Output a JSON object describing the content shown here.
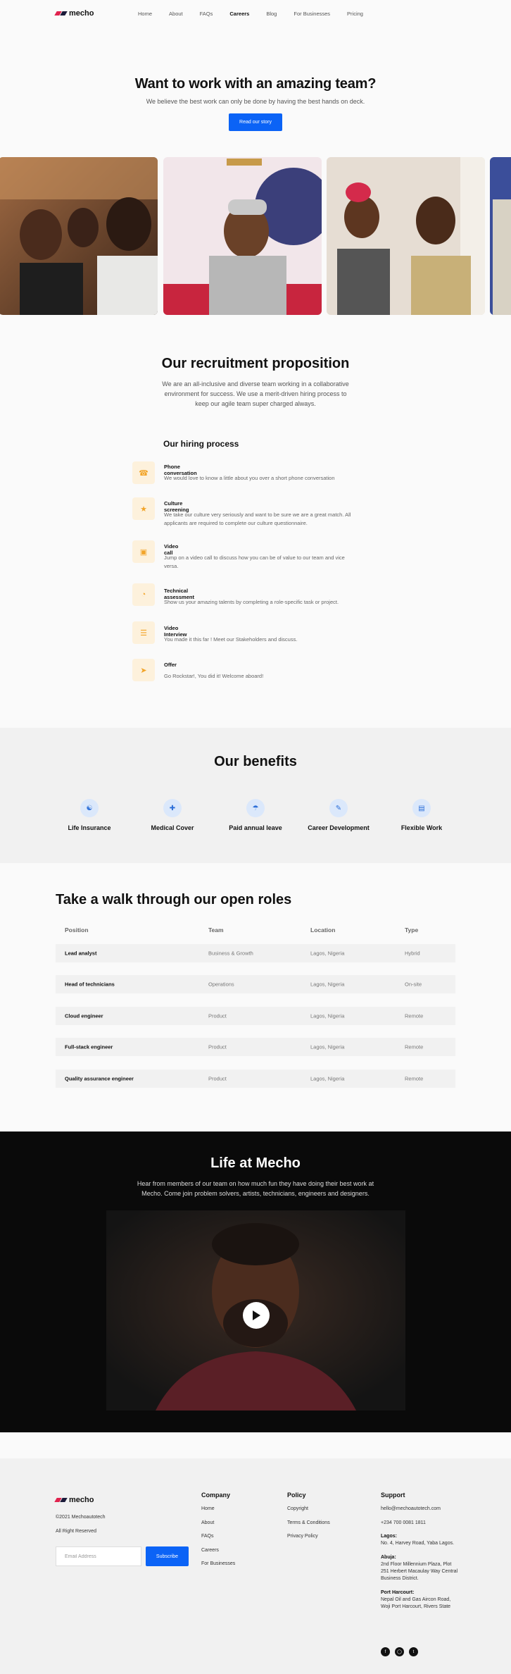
{
  "brand": {
    "name": "mecho",
    "colors": {
      "primary": "#0b63f6",
      "mark_red": "#e0234e",
      "mark_dark": "#1b1b3a",
      "accent_orange": "#f2a428"
    }
  },
  "nav": {
    "links": [
      {
        "label": "Home",
        "active": false
      },
      {
        "label": "About",
        "active": false
      },
      {
        "label": "FAQs",
        "active": false
      },
      {
        "label": "Careers",
        "active": true
      },
      {
        "label": "Blog",
        "active": false
      },
      {
        "label": "For Businesses",
        "active": false
      },
      {
        "label": "Pricing",
        "active": false
      }
    ]
  },
  "hero": {
    "title": "Want to work with an amazing team?",
    "subtitle": "We believe the best work can only be done by having the best hands on deck.",
    "cta": "Read our story"
  },
  "recruitment": {
    "title": "Our recruitment proposition",
    "text": "We are an all-inclusive and diverse team working in a collaborative environment for success. We use a merit-driven hiring process to keep our agile team super charged always."
  },
  "hiring": {
    "title": "Our hiring process",
    "steps": [
      {
        "icon": "phone-icon",
        "title": "Phone conversation",
        "desc": "We would love to know a little about you over a short phone conversation"
      },
      {
        "icon": "culture-icon",
        "title": "Culture screening",
        "desc": "We take our culture very seriously and want to be sure we are a great match. All applicants are required to complete our culture questionnaire."
      },
      {
        "icon": "video-call-icon",
        "title": "Video call",
        "desc": "Jump on a video call to discuss how you can be of value to our team and vice versa."
      },
      {
        "icon": "assessment-icon",
        "title": "Technical assessment",
        "desc": "Show us your amazing talents by completing a role-specific task or project."
      },
      {
        "icon": "interview-icon",
        "title": "Video Interview",
        "desc": "You made it this far ! Meet our Stakeholders and discuss."
      },
      {
        "icon": "offer-icon",
        "title": "Offer",
        "desc": "Go Rockstar!, You did it! Welcome aboard!"
      }
    ]
  },
  "benefits": {
    "title": "Our benefits",
    "items": [
      {
        "icon": "life-insurance-icon",
        "label": "Life Insurance"
      },
      {
        "icon": "medical-icon",
        "label": "Medical Cover"
      },
      {
        "icon": "umbrella-icon",
        "label": "Paid annual leave"
      },
      {
        "icon": "career-icon",
        "label": "Career Development"
      },
      {
        "icon": "flexible-icon",
        "label": "Flexible Work"
      }
    ]
  },
  "roles": {
    "title": "Take a walk through our open roles",
    "headers": [
      "Position",
      "Team",
      "Location",
      "Type"
    ],
    "rows": [
      [
        "Lead analyst",
        "Business & Growth",
        "Lagos, Nigeria",
        "Hybrid"
      ],
      [
        "Head of technicians",
        "Operations",
        "Lagos, Nigeria",
        "On-site"
      ],
      [
        "Cloud engineer",
        "Product",
        "Lagos, Nigeria",
        "Remote"
      ],
      [
        "Full-stack engineer",
        "Product",
        "Lagos, Nigeria",
        "Remote"
      ],
      [
        "Quality assurance engineer",
        "Product",
        "Lagos, Nigeria",
        "Remote"
      ]
    ]
  },
  "life": {
    "title": "Life at Mecho",
    "text": "Hear from members of our team on how much fun they have doing their best work at Mecho. Come join problem solvers, artists, technicians, engineers and designers."
  },
  "footer": {
    "copyright": "©2021 Mechoautotech",
    "rights": "All Right Reserved",
    "email_placeholder": "Email Address",
    "subscribe": "Subscribe",
    "company": {
      "title": "Company",
      "links": [
        "Home",
        "About",
        "FAQs",
        "Careers",
        "For Businesses"
      ]
    },
    "policy": {
      "title": "Policy",
      "links": [
        "Copyright",
        "Terms & Conditions",
        "Privacy Policy"
      ]
    },
    "support": {
      "title": "Support",
      "email": "hello@mechoautotech.com",
      "phone": "+234 700 0081 1811",
      "lagos_label": "Lagos:",
      "lagos": "No. 4, Harvey Road, Yaba Lagos.",
      "abuja_label": "Abuja:",
      "abuja": "2nd Floor Millennium Plaza, Plot 251 Herbert Macaulay Way Central Business District.",
      "ph_label": "Port Harcourt:",
      "ph": "Nepal Oil and Gas Aircon Road, Woji Port Harcourt, Rivers State"
    },
    "social": [
      "facebook-icon",
      "instagram-icon",
      "twitter-icon"
    ]
  }
}
